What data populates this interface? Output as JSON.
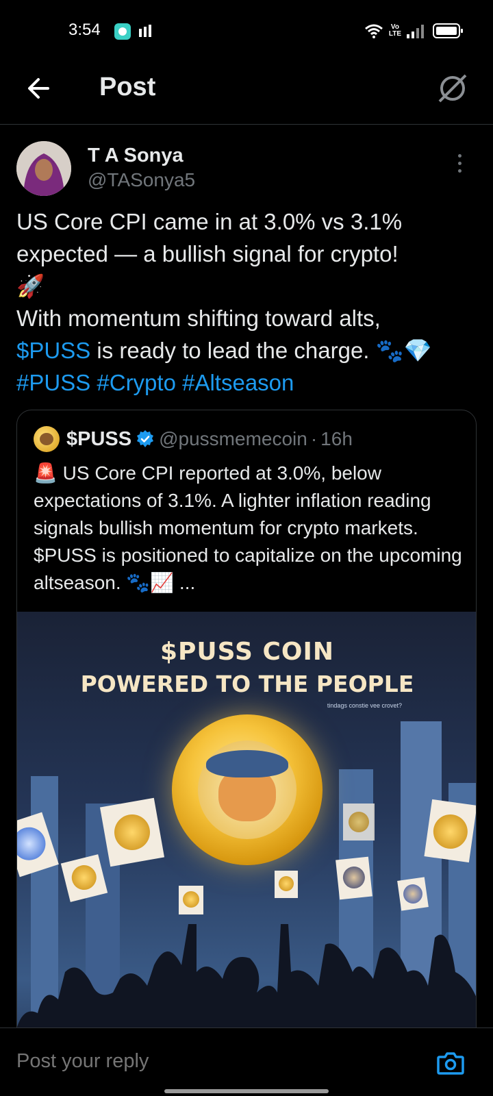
{
  "status_bar": {
    "time": "3:54",
    "volte": "Vo\nLTE",
    "app_icon": "messenger-icon",
    "icons": [
      "wifi-icon",
      "signal-icon",
      "battery-icon"
    ]
  },
  "app_bar": {
    "title": "Post",
    "back_icon": "back-arrow-icon",
    "grok_icon": "grok-icon"
  },
  "post": {
    "author": {
      "display_name": "T A Sonya",
      "handle": "@TASonya5"
    },
    "text_line1": "US Core CPI came in at 3.0% vs 3.1% expected — a bullish signal for crypto!",
    "rocket": "🚀",
    "text_line2": "With momentum shifting toward alts,",
    "cashtag": "$PUSS",
    "text_line3": " is ready to lead the charge. 🐾💎",
    "hashtags": "#PUSS #Crypto #Altseason"
  },
  "quoted_post": {
    "display_name": "$PUSS",
    "handle": "@pussmemecoin",
    "separator": "·",
    "time": "16h",
    "text": "🚨 US Core CPI reported at 3.0%, below expectations of 3.1%. A lighter inflation reading signals bullish momentum for crypto markets. $PUSS is positioned to capitalize on the upcoming altseason. 🐾📈 ...",
    "image": {
      "title_line1": "$PUSS COIN",
      "title_line2": "POWERED TO THE PEOPLE",
      "small_text": "tindags constie vee crovet?"
    }
  },
  "reply": {
    "placeholder": "Post your reply",
    "camera_icon": "camera-icon"
  },
  "colors": {
    "background": "#000000",
    "text": "#e7e9ea",
    "secondary": "#71767b",
    "link": "#1d9bf0",
    "divider": "#2f3336"
  }
}
